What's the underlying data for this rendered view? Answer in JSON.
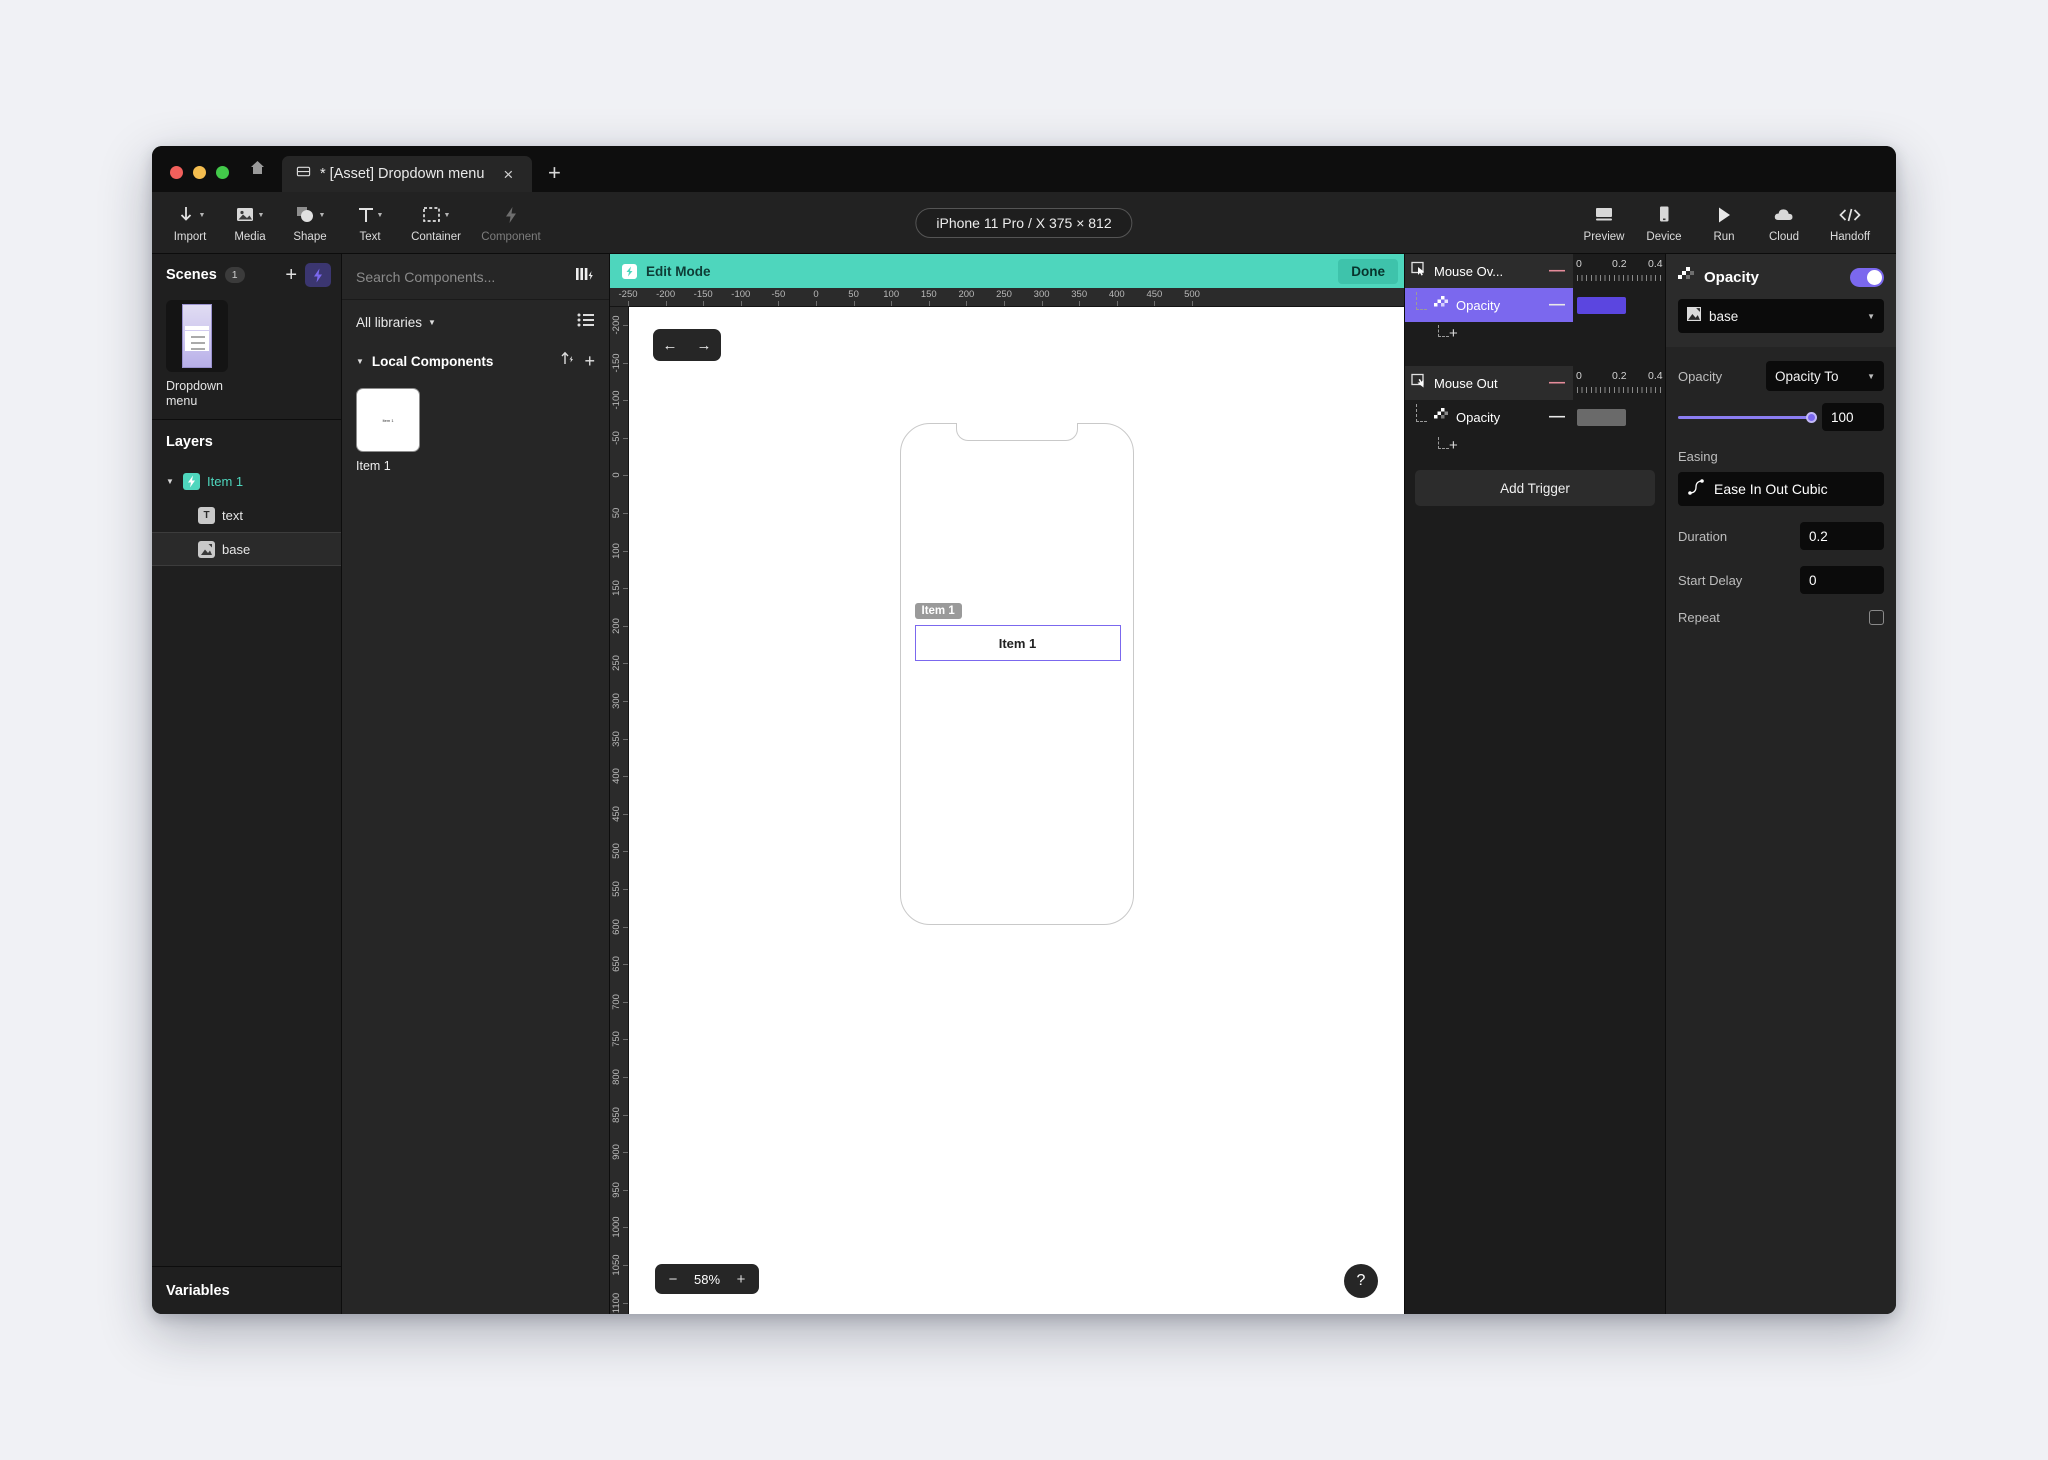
{
  "window": {
    "tab": {
      "title": "* [Asset] Dropdown menu",
      "close_label": "×",
      "new_tab_label": "+"
    }
  },
  "toolbar": {
    "items": [
      {
        "label": "Import",
        "icon": "import-arrow-icon",
        "dim": false
      },
      {
        "label": "Media",
        "icon": "media-image-icon",
        "dim": false
      },
      {
        "label": "Shape",
        "icon": "shape-icon",
        "dim": false
      },
      {
        "label": "Text",
        "icon": "text-t-icon",
        "dim": false
      },
      {
        "label": "Container",
        "icon": "container-dashed-icon",
        "dim": false
      },
      {
        "label": "Component",
        "icon": "component-bolt-icon",
        "dim": true
      }
    ],
    "device_pill": "iPhone 11 Pro / X  375 × 812",
    "right_items": [
      {
        "label": "Preview",
        "icon": "preview-monitor-icon"
      },
      {
        "label": "Device",
        "icon": "device-phone-icon"
      },
      {
        "label": "Run",
        "icon": "run-play-icon"
      },
      {
        "label": "Cloud",
        "icon": "cloud-icon"
      },
      {
        "label": "Handoff",
        "icon": "handoff-code-icon"
      }
    ]
  },
  "scenes": {
    "title": "Scenes",
    "count": "1",
    "add_label": "+",
    "items": [
      {
        "label": "Dropdown menu"
      }
    ]
  },
  "layers": {
    "title": "Layers",
    "items": [
      {
        "label": "Item 1",
        "icon": "component-bolt-icon",
        "depth": 0,
        "selected": false,
        "expanded": true
      },
      {
        "label": "text",
        "icon": "text-t-icon",
        "depth": 1,
        "selected": false
      },
      {
        "label": "base",
        "icon": "image-layer-icon",
        "depth": 1,
        "selected": true
      }
    ]
  },
  "variables": {
    "title": "Variables"
  },
  "components": {
    "search_placeholder": "Search Components...",
    "search_value": "",
    "libraries_label": "All libraries",
    "group_label": "Local Components",
    "items": [
      {
        "label": "Item 1",
        "thumb_text": "Item 1"
      }
    ]
  },
  "canvas": {
    "edit_mode_label": "Edit Mode",
    "done_label": "Done",
    "nav_back": "←",
    "nav_forward": "→",
    "ruler_h": [
      "-250",
      "-200",
      "-150",
      "-100",
      "-50",
      "0",
      "50",
      "100",
      "150",
      "200",
      "250",
      "300",
      "350",
      "400",
      "450",
      "500"
    ],
    "ruler_v": [
      "-200",
      "-150",
      "-100",
      "-50",
      "0",
      "50",
      "100",
      "150",
      "200",
      "250",
      "300",
      "350",
      "400",
      "450",
      "500",
      "550",
      "600",
      "650",
      "700",
      "750",
      "800",
      "850",
      "900",
      "950",
      "1000",
      "1050",
      "1100"
    ],
    "selection_badge": "Item 1",
    "selection_text": "Item 1",
    "zoom_minus": "−",
    "zoom_value": "58%",
    "zoom_plus": "+",
    "help_label": "?"
  },
  "timeline": {
    "triggers": [
      {
        "name": "Mouse Ov...",
        "icon": "mouse-over-icon",
        "ruler": [
          "0",
          "0.2",
          "0.4"
        ],
        "properties": [
          {
            "name": "Opacity",
            "selected": true,
            "bar_color": "purple"
          }
        ],
        "add_label": "+"
      },
      {
        "name": "Mouse Out",
        "icon": "mouse-out-icon",
        "ruler": [
          "0",
          "0.2",
          "0.4"
        ],
        "properties": [
          {
            "name": "Opacity",
            "selected": false,
            "bar_color": "gray"
          }
        ],
        "add_label": "+"
      }
    ],
    "add_trigger_label": "Add Trigger"
  },
  "properties": {
    "title": "Opacity",
    "toggle_on": true,
    "target_layer": "base",
    "opacity_label": "Opacity",
    "opacity_mode": "Opacity To",
    "opacity_value": "100",
    "easing_label": "Easing",
    "easing_value": "Ease In Out Cubic",
    "duration_label": "Duration",
    "duration_value": "0.2",
    "start_delay_label": "Start Delay",
    "start_delay_value": "0",
    "repeat_label": "Repeat",
    "repeat_checked": false
  },
  "colors": {
    "accent_purple": "#7b68ee",
    "accent_teal": "#4ed6bd",
    "keyframe_purple": "#5b46e0",
    "keyframe_gray": "#6a6a6a"
  }
}
